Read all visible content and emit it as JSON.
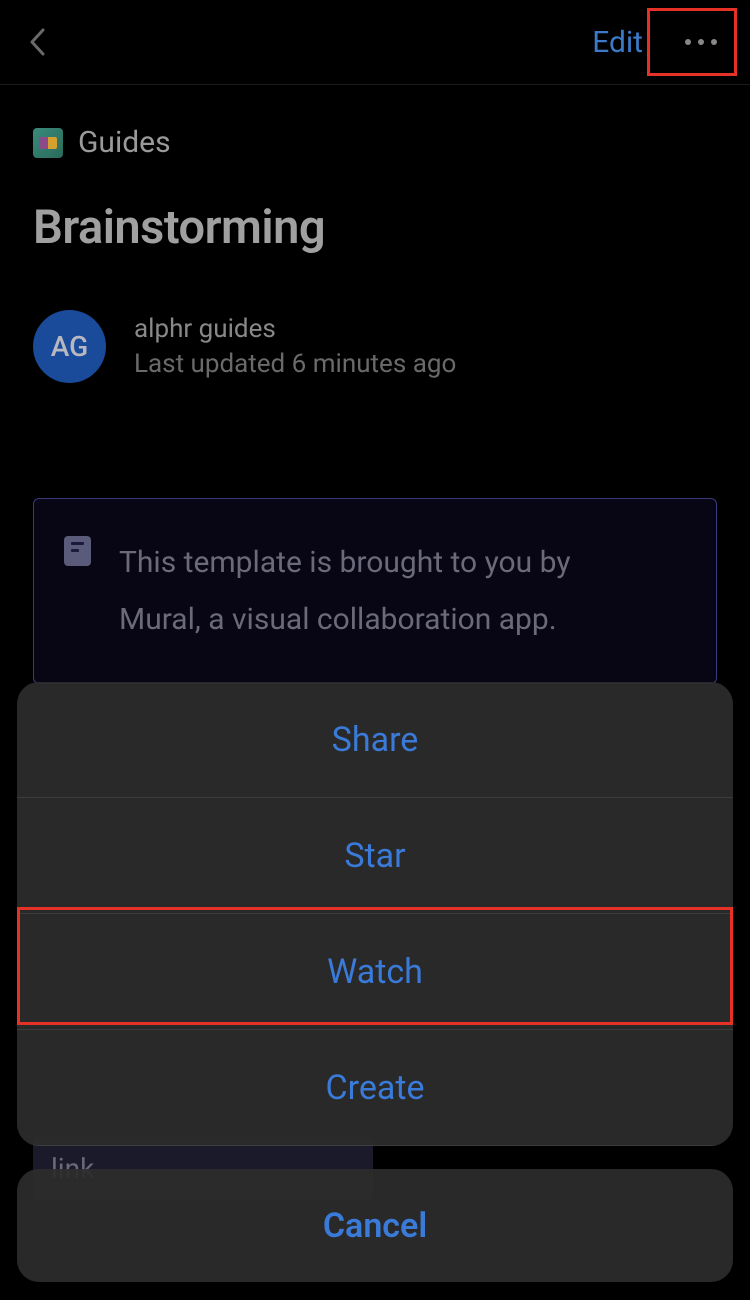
{
  "header": {
    "edit_label": "Edit"
  },
  "breadcrumb": {
    "label": "Guides"
  },
  "page": {
    "title": "Brainstorming"
  },
  "author": {
    "initials": "AG",
    "name": "alphr guides",
    "updated": "Last updated 6 minutes ago"
  },
  "info_panel": {
    "text": "This template is brought to you by Mural, a visual collaboration app."
  },
  "partial_visible": {
    "text": "link"
  },
  "action_sheet": {
    "items": [
      {
        "label": "Share"
      },
      {
        "label": "Star"
      },
      {
        "label": "Watch"
      },
      {
        "label": "Create"
      }
    ],
    "cancel_label": "Cancel"
  }
}
